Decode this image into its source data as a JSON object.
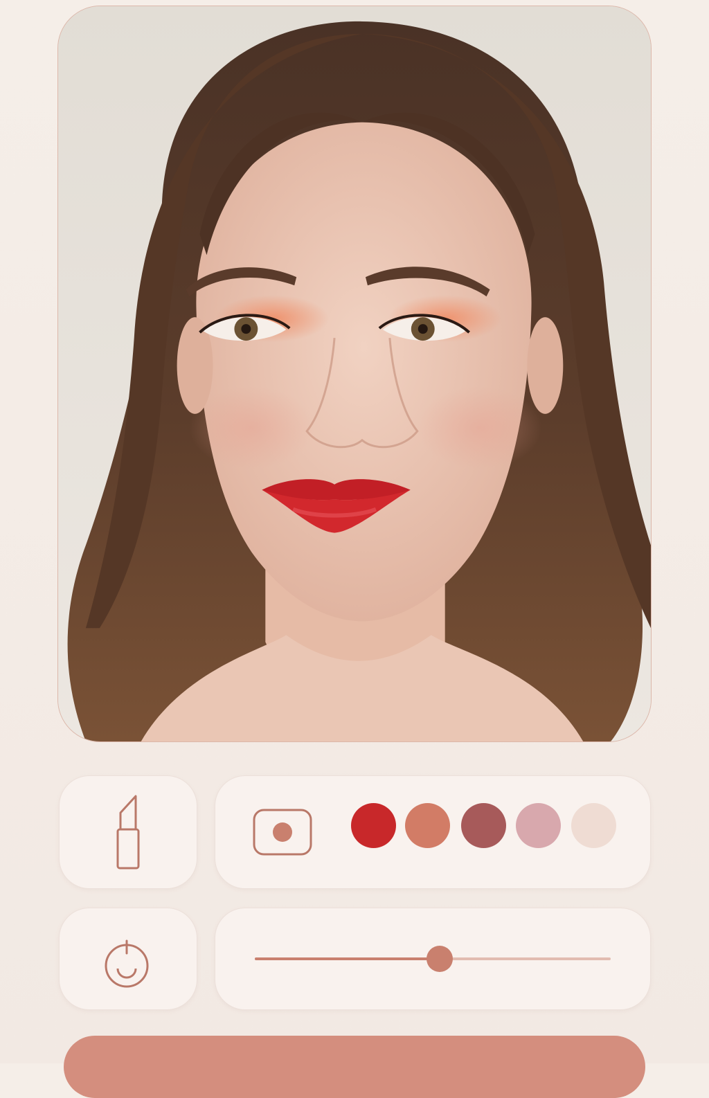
{
  "app": {
    "screen": "virtual-makeup-try-on"
  },
  "photo": {
    "subject": "portrait-woman-red-lips"
  },
  "tools": {
    "lipstick_icon": "lipstick-icon",
    "camera_icon": "camera-icon",
    "power_icon": "power-icon"
  },
  "shades": [
    {
      "name": "red",
      "color": "#c8282a",
      "selected": true
    },
    {
      "name": "terracotta",
      "color": "#d27c66",
      "selected": false
    },
    {
      "name": "mauve",
      "color": "#a75a5a",
      "selected": false
    },
    {
      "name": "dusty-pink",
      "color": "#d8a8ad",
      "selected": false
    },
    {
      "name": "nude",
      "color": "#efdcd3",
      "selected": false
    }
  ],
  "intensity": {
    "value": 0.52
  },
  "apply_button": {
    "label": ""
  },
  "colors": {
    "accent": "#c9806e",
    "button": "#d48e7e",
    "panel": "#f9f2ee",
    "background": "#f4ece6",
    "icon_stroke": "#b97868"
  }
}
